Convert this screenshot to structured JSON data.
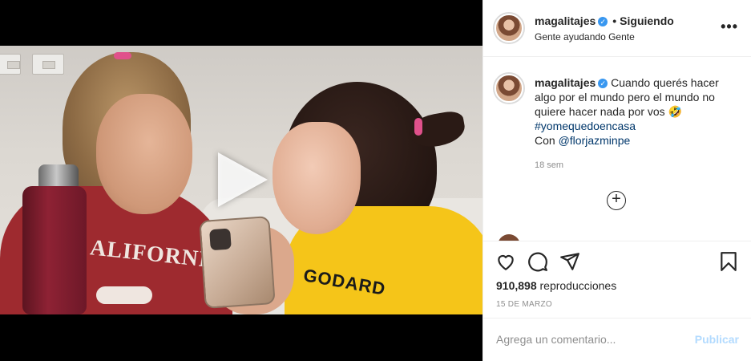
{
  "post": {
    "username": "magalitajes",
    "verified_icon": "verified-badge-icon",
    "follow_status": "Siguiendo",
    "location": "Gente ayudando Gente",
    "more_icon": "more-options-icon"
  },
  "caption": {
    "username": "magalitajes",
    "text": "Cuando querés hacer algo por el mundo pero el mundo no quiere hacer nada por vos 🤣",
    "hashtag": "#yomequedoencasa",
    "with_prefix": "Con ",
    "mention": "@florjazminpe",
    "time_ago": "18 sem"
  },
  "video": {
    "shirt_left_text": "ALIFORNIA",
    "shirt_right_text": "GODARD",
    "play_icon": "play-icon"
  },
  "actions": {
    "like_icon": "heart-icon",
    "comment_icon": "comment-icon",
    "share_icon": "paper-plane-icon",
    "save_icon": "bookmark-icon",
    "views_count": "910,898",
    "views_label": " reproducciones",
    "date": "15 DE MARZO"
  },
  "comment_box": {
    "placeholder": "Agrega un comentario...",
    "publish_label": "Publicar"
  },
  "colors": {
    "link": "#00376b",
    "verified": "#3897f0",
    "publish_disabled": "#b3dbff",
    "muted": "#8e8e8e"
  }
}
